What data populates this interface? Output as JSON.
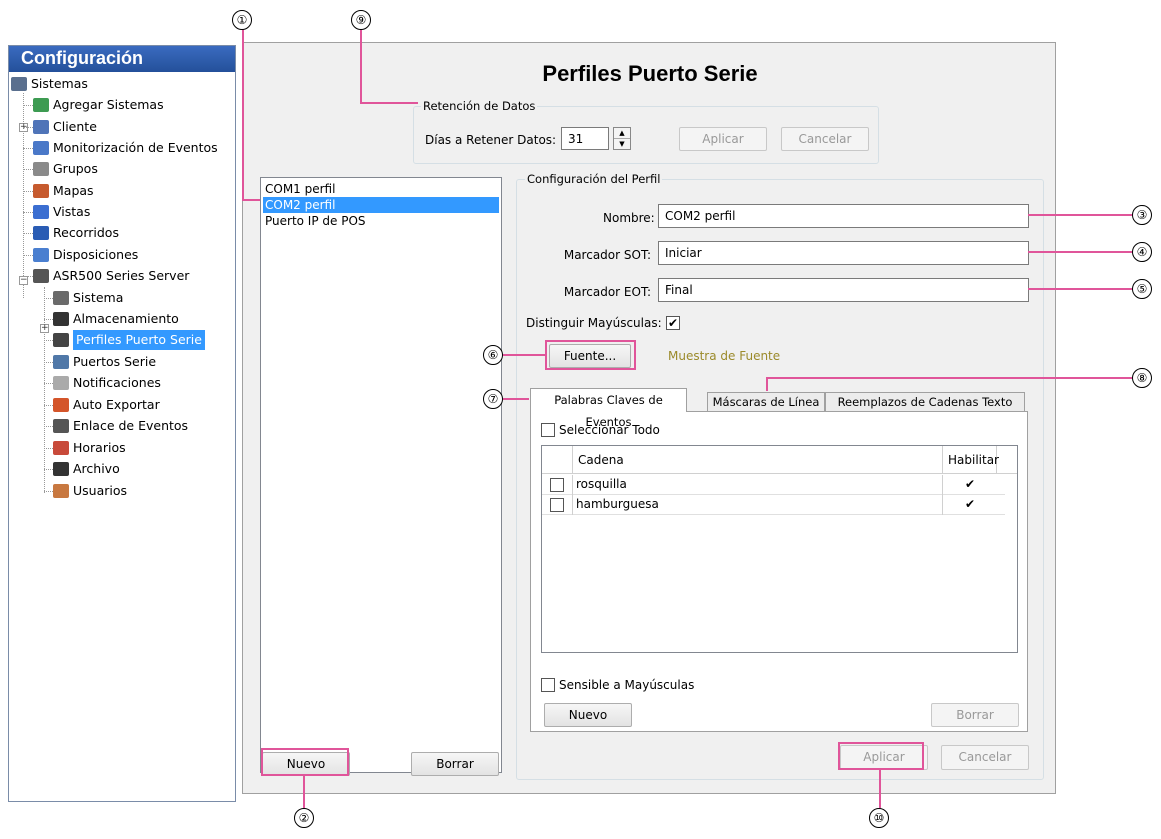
{
  "sidebar": {
    "title": "Configuración",
    "items": [
      {
        "label": "Sistemas",
        "color": "#5a6f8e"
      },
      {
        "label": "Agregar Sistemas",
        "color": "#3d9b52"
      },
      {
        "label": "Cliente",
        "color": "#4f74b8"
      },
      {
        "label": "Monitorización de Eventos",
        "color": "#4a78c8"
      },
      {
        "label": "Grupos",
        "color": "#8a8a8a"
      },
      {
        "label": "Mapas",
        "color": "#c65a2e"
      },
      {
        "label": "Vistas",
        "color": "#3b6ed1"
      },
      {
        "label": "Recorridos",
        "color": "#2a5cb4"
      },
      {
        "label": "Disposiciones",
        "color": "#4a7fd0"
      },
      {
        "label": "ASR500 Series Server",
        "color": "#555555"
      },
      {
        "label": "Sistema",
        "color": "#6a6a6a"
      },
      {
        "label": "Almacenamiento",
        "color": "#333333"
      },
      {
        "label": "Perfiles Puerto Serie",
        "color": "#444444"
      },
      {
        "label": "Puertos Serie",
        "color": "#5078a8"
      },
      {
        "label": "Notificaciones",
        "color": "#aaaaaa"
      },
      {
        "label": "Auto Exportar",
        "color": "#d4552a"
      },
      {
        "label": "Enlace de Eventos",
        "color": "#555555"
      },
      {
        "label": "Horarios",
        "color": "#c84a3a"
      },
      {
        "label": "Archivo",
        "color": "#333333"
      },
      {
        "label": "Usuarios",
        "color": "#c87840"
      }
    ]
  },
  "main": {
    "title": "Perfiles Puerto Serie",
    "retention": {
      "group_label": "Retención de Datos",
      "days_label": "Días a Retener Datos:",
      "days_value": "31",
      "apply": "Aplicar",
      "cancel": "Cancelar"
    },
    "profiles": {
      "items": [
        "COM1 perfil",
        "COM2 perfil",
        "Puerto IP de POS"
      ],
      "selected_index": 1,
      "new": "Nuevo",
      "delete": "Borrar"
    },
    "config": {
      "group_label": "Configuración del Perfil",
      "name_label": "Nombre:",
      "name_value": "COM2 perfil",
      "sot_label": "Marcador SOT:",
      "sot_value": "Iniciar",
      "eot_label": "Marcador EOT:",
      "eot_value": "Final",
      "case_label": "Distinguir Mayúsculas:",
      "case_checked": true,
      "font_button": "Fuente...",
      "font_sample": "Muestra de Fuente",
      "font_sample_color": "#9b8a2a",
      "tabs": [
        "Palabras Claves de Eventos",
        "Máscaras de Línea",
        "Reemplazos de Cadenas Texto"
      ],
      "active_tab": 0,
      "select_all": "Seleccionar Todo",
      "col_string": "Cadena",
      "col_enable": "Habilitar",
      "rows": [
        {
          "value": "rosquilla",
          "enabled": true
        },
        {
          "value": "hamburguesa",
          "enabled": true
        }
      ],
      "case_sensitive": "Sensible a Mayúsculas",
      "new": "Nuevo",
      "delete": "Borrar",
      "apply": "Aplicar",
      "cancel": "Cancelar"
    }
  },
  "callouts": [
    "①",
    "②",
    "③",
    "④",
    "⑤",
    "⑥",
    "⑦",
    "⑧",
    "⑨",
    "⑩"
  ],
  "colors": {
    "highlight": "#e0559a",
    "selection": "#3399ff",
    "title_bar": "#24509a"
  }
}
